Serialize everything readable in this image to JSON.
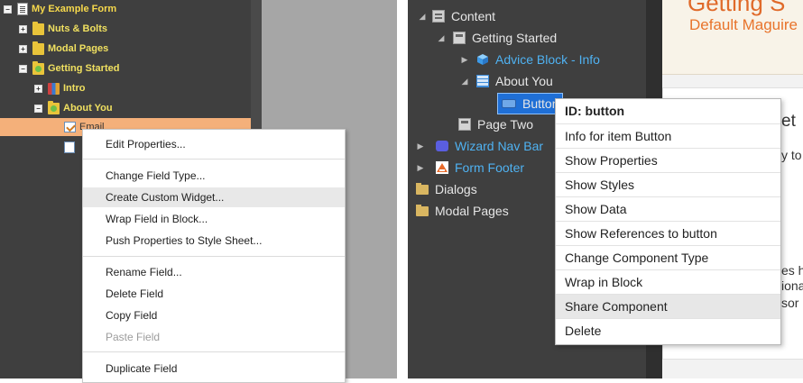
{
  "left_tree": {
    "root": "My Example Form",
    "items": [
      {
        "label": "Nuts & Bolts"
      },
      {
        "label": "Modal Pages"
      },
      {
        "label": "Getting Started"
      },
      {
        "label": "Intro"
      },
      {
        "label": "About You"
      },
      {
        "label": "Email"
      }
    ]
  },
  "left_menu": {
    "items": [
      "Edit Properties...",
      "Change Field Type...",
      "Create Custom Widget...",
      "Wrap Field in Block...",
      "Push Properties to Style Sheet...",
      "Rename Field...",
      "Delete Field",
      "Copy Field",
      "Paste Field",
      "Duplicate Field"
    ],
    "highlighted": "Create Custom Widget...",
    "disabled": "Paste Field"
  },
  "right_tree": {
    "items": [
      {
        "label": "Content",
        "icon": "content-icon"
      },
      {
        "label": "Getting Started",
        "icon": "page-icon"
      },
      {
        "label": "Advice Block - Info",
        "icon": "cube-icon"
      },
      {
        "label": "About You",
        "icon": "grid-icon"
      },
      {
        "label": "Button",
        "icon": "button-icon"
      },
      {
        "label": "Page Two",
        "icon": "page-icon"
      },
      {
        "label": "Wizard Nav Bar",
        "icon": "puzzle-icon"
      },
      {
        "label": "Form Footer",
        "icon": "footer-icon"
      },
      {
        "label": "Dialogs",
        "icon": "folder-icon"
      },
      {
        "label": "Modal Pages",
        "icon": "folder-icon"
      }
    ]
  },
  "right_menu": {
    "header": "ID: button",
    "items": [
      "Info for item Button",
      "Show Properties",
      "Show Styles",
      "Show Data",
      "Show References to button",
      "Change Component Type",
      "Wrap in Block",
      "Share Component",
      "Delete"
    ],
    "highlighted": "Share Component"
  },
  "canvas": {
    "title": "Getting S",
    "subtitle": "Default Maguire",
    "frag_1": "et",
    "frag_2": "y to a",
    "frag_3": "es h",
    "frag_4": "iona",
    "frag_5": "sor"
  },
  "colors": {
    "tree_bg": "#3f3f3f",
    "tree_text_left": "#f0e060",
    "tree_text_blue": "#4fb2f2",
    "selected_row": "#f4b07a",
    "selected_node": "#1f6fd6",
    "accent_orange": "#e06a2a"
  }
}
